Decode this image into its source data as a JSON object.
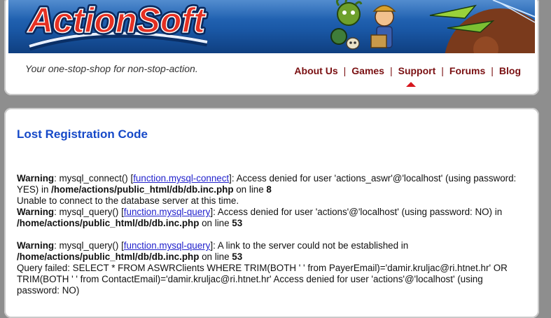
{
  "header": {
    "logo_text": "ActionSoft",
    "tagline": "Your one-stop-shop for non-stop-action.",
    "nav": [
      {
        "label": "About Us"
      },
      {
        "label": "Games"
      },
      {
        "label": "Support",
        "active": true
      },
      {
        "label": "Forums"
      },
      {
        "label": "Blog"
      }
    ],
    "separator": "|",
    "colors": {
      "banner": "#1a58a6",
      "nav_link": "#7a1012",
      "active_marker": "#d6171e"
    }
  },
  "main": {
    "title": "Lost Registration Code",
    "title_color": "#1649c8",
    "messages": {
      "w1": {
        "label": "Warning",
        "colon": ": ",
        "func": "mysql_connect() [",
        "link": "function.mysql-connect",
        "text": "]: Access denied for user 'actions_aswr'@'localhost' (using password: YES) in ",
        "path": "/home/actions/public_html/db/db.inc.php",
        "online": " on line ",
        "line": "8"
      },
      "plain1": "Unable to connect to the database server at this time.",
      "w2": {
        "label": "Warning",
        "colon": ": ",
        "func": "mysql_query() [",
        "link": "function.mysql-query",
        "text": "]: Access denied for user 'actions'@'localhost' (using password: NO) in ",
        "path": "/home/actions/public_html/db/db.inc.php",
        "online": " on line ",
        "line": "53"
      },
      "w3": {
        "label": "Warning",
        "colon": ": ",
        "func": "mysql_query() [",
        "link": "function.mysql-query",
        "text": "]: A link to the server could not be established in ",
        "path": "/home/actions/public_html/db/db.inc.php",
        "online": " on line ",
        "line": "53"
      },
      "query_failed": "Query failed: SELECT * FROM ASWRClients WHERE TRIM(BOTH ' ' from PayerEmail)='damir.kruljac@ri.htnet.hr' OR TRIM(BOTH ' ' from ContactEmail)='damir.kruljac@ri.htnet.hr' Access denied for user 'actions'@'localhost' (using password: NO)"
    }
  }
}
